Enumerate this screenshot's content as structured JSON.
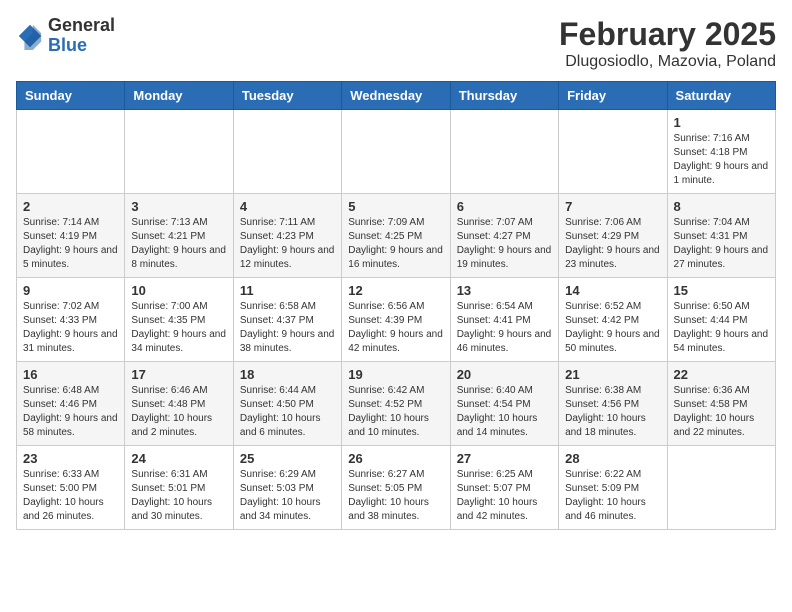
{
  "header": {
    "title": "February 2025",
    "subtitle": "Dlugosiodlo, Mazovia, Poland",
    "logo_general": "General",
    "logo_blue": "Blue"
  },
  "days_of_week": [
    "Sunday",
    "Monday",
    "Tuesday",
    "Wednesday",
    "Thursday",
    "Friday",
    "Saturday"
  ],
  "weeks": [
    {
      "days": [
        {
          "num": "",
          "info": ""
        },
        {
          "num": "",
          "info": ""
        },
        {
          "num": "",
          "info": ""
        },
        {
          "num": "",
          "info": ""
        },
        {
          "num": "",
          "info": ""
        },
        {
          "num": "",
          "info": ""
        },
        {
          "num": "1",
          "info": "Sunrise: 7:16 AM\nSunset: 4:18 PM\nDaylight: 9 hours and 1 minute."
        }
      ]
    },
    {
      "days": [
        {
          "num": "2",
          "info": "Sunrise: 7:14 AM\nSunset: 4:19 PM\nDaylight: 9 hours and 5 minutes."
        },
        {
          "num": "3",
          "info": "Sunrise: 7:13 AM\nSunset: 4:21 PM\nDaylight: 9 hours and 8 minutes."
        },
        {
          "num": "4",
          "info": "Sunrise: 7:11 AM\nSunset: 4:23 PM\nDaylight: 9 hours and 12 minutes."
        },
        {
          "num": "5",
          "info": "Sunrise: 7:09 AM\nSunset: 4:25 PM\nDaylight: 9 hours and 16 minutes."
        },
        {
          "num": "6",
          "info": "Sunrise: 7:07 AM\nSunset: 4:27 PM\nDaylight: 9 hours and 19 minutes."
        },
        {
          "num": "7",
          "info": "Sunrise: 7:06 AM\nSunset: 4:29 PM\nDaylight: 9 hours and 23 minutes."
        },
        {
          "num": "8",
          "info": "Sunrise: 7:04 AM\nSunset: 4:31 PM\nDaylight: 9 hours and 27 minutes."
        }
      ]
    },
    {
      "days": [
        {
          "num": "9",
          "info": "Sunrise: 7:02 AM\nSunset: 4:33 PM\nDaylight: 9 hours and 31 minutes."
        },
        {
          "num": "10",
          "info": "Sunrise: 7:00 AM\nSunset: 4:35 PM\nDaylight: 9 hours and 34 minutes."
        },
        {
          "num": "11",
          "info": "Sunrise: 6:58 AM\nSunset: 4:37 PM\nDaylight: 9 hours and 38 minutes."
        },
        {
          "num": "12",
          "info": "Sunrise: 6:56 AM\nSunset: 4:39 PM\nDaylight: 9 hours and 42 minutes."
        },
        {
          "num": "13",
          "info": "Sunrise: 6:54 AM\nSunset: 4:41 PM\nDaylight: 9 hours and 46 minutes."
        },
        {
          "num": "14",
          "info": "Sunrise: 6:52 AM\nSunset: 4:42 PM\nDaylight: 9 hours and 50 minutes."
        },
        {
          "num": "15",
          "info": "Sunrise: 6:50 AM\nSunset: 4:44 PM\nDaylight: 9 hours and 54 minutes."
        }
      ]
    },
    {
      "days": [
        {
          "num": "16",
          "info": "Sunrise: 6:48 AM\nSunset: 4:46 PM\nDaylight: 9 hours and 58 minutes."
        },
        {
          "num": "17",
          "info": "Sunrise: 6:46 AM\nSunset: 4:48 PM\nDaylight: 10 hours and 2 minutes."
        },
        {
          "num": "18",
          "info": "Sunrise: 6:44 AM\nSunset: 4:50 PM\nDaylight: 10 hours and 6 minutes."
        },
        {
          "num": "19",
          "info": "Sunrise: 6:42 AM\nSunset: 4:52 PM\nDaylight: 10 hours and 10 minutes."
        },
        {
          "num": "20",
          "info": "Sunrise: 6:40 AM\nSunset: 4:54 PM\nDaylight: 10 hours and 14 minutes."
        },
        {
          "num": "21",
          "info": "Sunrise: 6:38 AM\nSunset: 4:56 PM\nDaylight: 10 hours and 18 minutes."
        },
        {
          "num": "22",
          "info": "Sunrise: 6:36 AM\nSunset: 4:58 PM\nDaylight: 10 hours and 22 minutes."
        }
      ]
    },
    {
      "days": [
        {
          "num": "23",
          "info": "Sunrise: 6:33 AM\nSunset: 5:00 PM\nDaylight: 10 hours and 26 minutes."
        },
        {
          "num": "24",
          "info": "Sunrise: 6:31 AM\nSunset: 5:01 PM\nDaylight: 10 hours and 30 minutes."
        },
        {
          "num": "25",
          "info": "Sunrise: 6:29 AM\nSunset: 5:03 PM\nDaylight: 10 hours and 34 minutes."
        },
        {
          "num": "26",
          "info": "Sunrise: 6:27 AM\nSunset: 5:05 PM\nDaylight: 10 hours and 38 minutes."
        },
        {
          "num": "27",
          "info": "Sunrise: 6:25 AM\nSunset: 5:07 PM\nDaylight: 10 hours and 42 minutes."
        },
        {
          "num": "28",
          "info": "Sunrise: 6:22 AM\nSunset: 5:09 PM\nDaylight: 10 hours and 46 minutes."
        },
        {
          "num": "",
          "info": ""
        }
      ]
    }
  ]
}
